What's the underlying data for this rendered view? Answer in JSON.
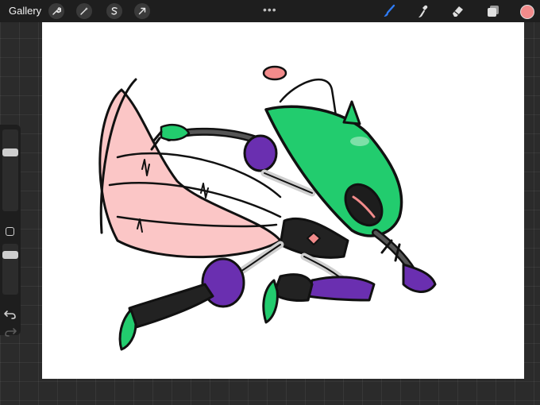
{
  "toolbar": {
    "gallery_label": "Gallery",
    "left_tools": [
      "wrench-icon",
      "magic-wand-icon",
      "selection-icon",
      "transform-arrow-icon"
    ],
    "more_label": "•••",
    "right_tools": [
      "brush-icon",
      "smudge-icon",
      "eraser-icon",
      "layers-icon"
    ],
    "active_tool": "brush-icon",
    "active_color": "#f28b8b"
  },
  "sidebar": {
    "brush_size_level": 0.12,
    "opacity_level": 0.25,
    "undo_icon": "undo-icon",
    "redo_icon": "redo-icon"
  },
  "colors": {
    "accent": "#2f7cf6",
    "insect_green": "#22cc6e",
    "wing_pink": "#f9b3b3",
    "armor_purple": "#6a2fb0"
  }
}
